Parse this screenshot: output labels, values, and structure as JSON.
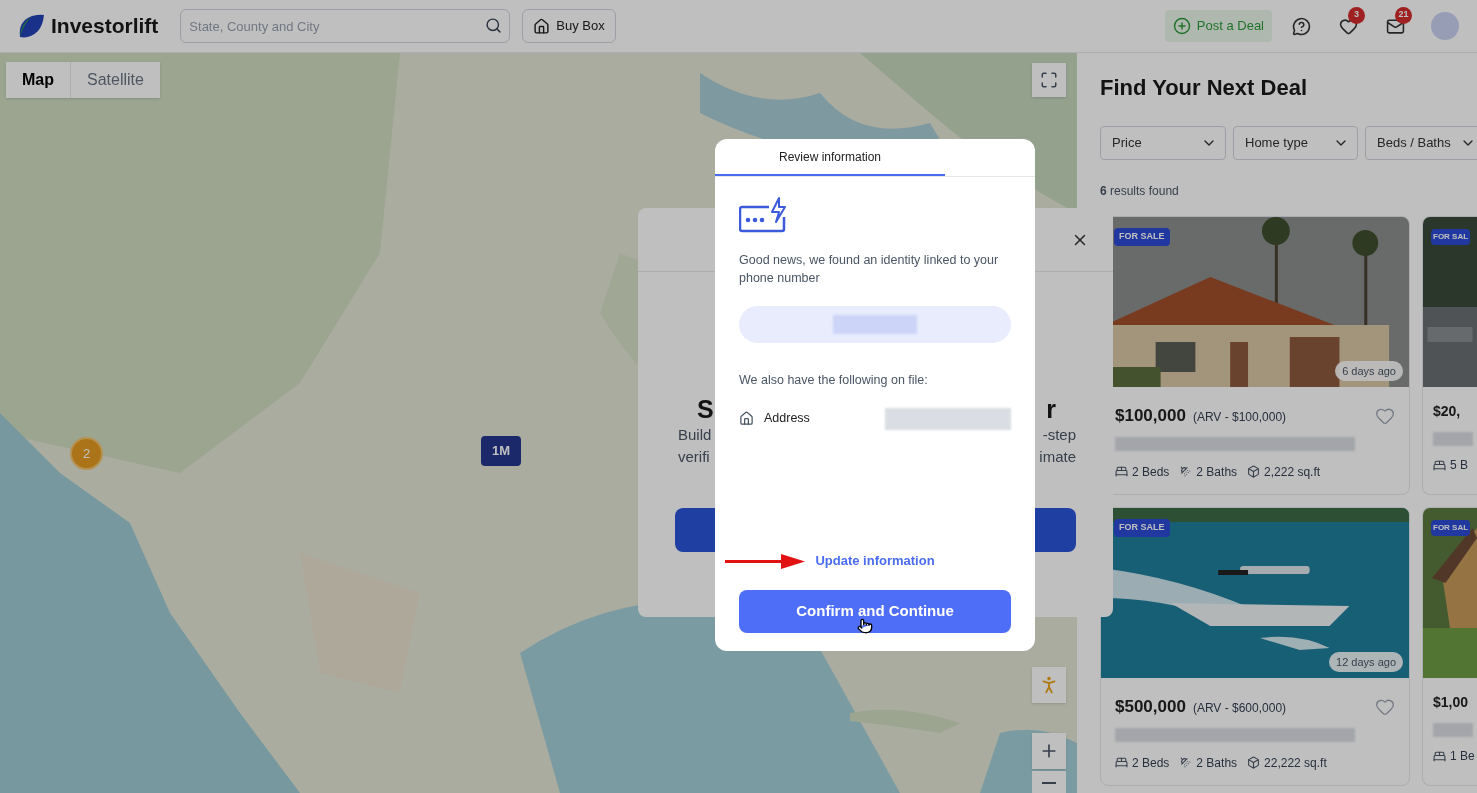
{
  "header": {
    "logo": "Investorlift",
    "search": {
      "placeholder": "State, County and City"
    },
    "buy_box": "Buy Box",
    "post_deal": "Post a Deal",
    "notifications": [
      {
        "kind": "heart",
        "count": "3"
      },
      {
        "kind": "mail",
        "count": "21"
      }
    ]
  },
  "map": {
    "type_toggle": [
      {
        "label": "Map",
        "selected": true
      },
      {
        "label": "Satellite",
        "selected": false
      }
    ],
    "markers": [
      {
        "kind": "cluster",
        "label": "2"
      },
      {
        "kind": "price",
        "label": "1M"
      }
    ]
  },
  "listings": {
    "title": "Find Your Next Deal",
    "filters": [
      "Price",
      "Home type",
      "Beds / Baths"
    ],
    "results": "**6** results found",
    "cards": [
      {
        "kind": "full",
        "badge": "FOR SALE",
        "age": "6 days ago",
        "price": "$100,000",
        "arv": "(ARV - $100,000)",
        "beds": "2 Beds",
        "baths": "2 Baths",
        "area": "2,222 sq.ft"
      },
      {
        "kind": "partial",
        "badge": "FOR SAL",
        "price": "$20,",
        "beds": "5 B"
      },
      {
        "kind": "full",
        "badge": "FOR SALE",
        "age": "12 days ago",
        "price": "$500,000",
        "arv": "(ARV - $600,000)",
        "beds": "2 Beds",
        "baths": "2 Baths",
        "area": "22,222 sq.ft"
      },
      {
        "kind": "partial",
        "badge": "FOR SAL",
        "price": "$1,00",
        "beds": "1 Be"
      }
    ]
  },
  "background_dialog": {
    "left": {
      "heading": "S",
      "lines": [
        "Build",
        "verifi"
      ]
    },
    "right": {
      "heading": "r",
      "lines": [
        "-step",
        "imate"
      ]
    }
  },
  "dialog": {
    "tabs": [
      {
        "label": "Review information",
        "selected": true
      }
    ],
    "message": "Good news, we found an identity linked to your phone number",
    "on_file_label": "We also have the following on file:",
    "fields": [
      {
        "label": "Address"
      }
    ],
    "update_link": "Update information",
    "confirm_button": "Confirm and Continue"
  }
}
